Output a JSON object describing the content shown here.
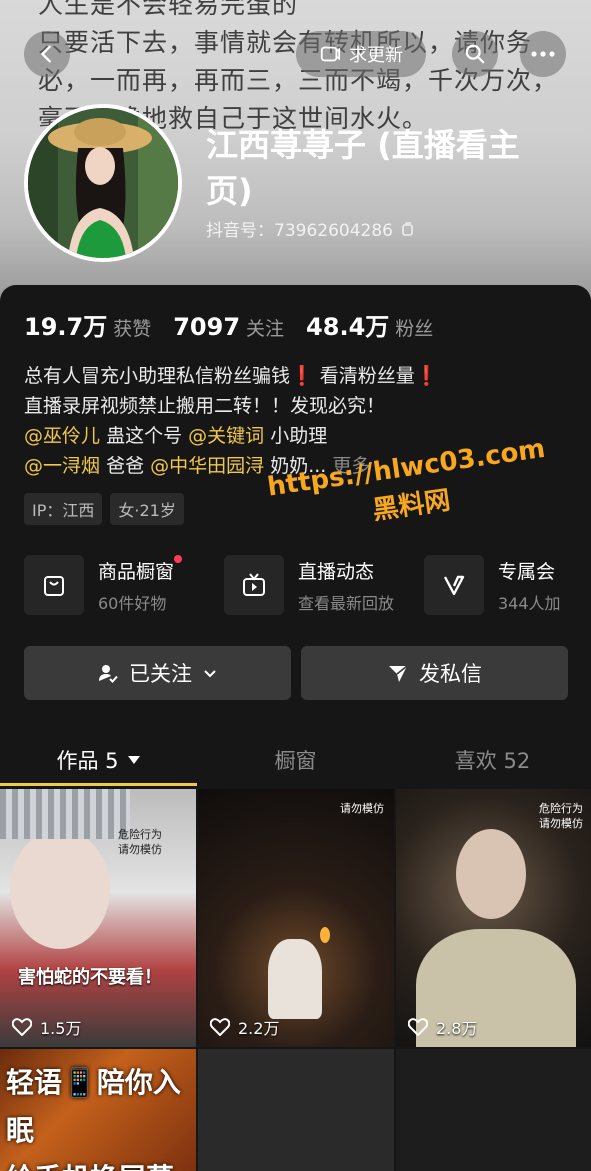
{
  "banner": {
    "background_text": "人生是不会轻易完蛋的\n只要活下去，事情就会有转机所以，请你务必，一而再，再而三，三而不竭，千次万次，毫不犹豫地救自己于这世间水火。",
    "update_label": "求更新"
  },
  "profile": {
    "name": "江西荨荨子 (直播看主页)",
    "douyin_id": "抖音号：73962604286"
  },
  "stats": [
    {
      "value": "19.7万",
      "label": "获赞"
    },
    {
      "value": "7097",
      "label": "关注"
    },
    {
      "value": "48.4万",
      "label": "粉丝"
    }
  ],
  "bio": {
    "line1": "总有人冒充小助理私信粉丝骗钱",
    "line1b": "看清粉丝量",
    "line2": "直播录屏视频禁止搬用二转！！发现必究！",
    "line3_tag1": "@巫伶儿",
    "line3_text": "蛊这个号",
    "line3_tag2": "@关键词",
    "line3_text2": "小助理",
    "line4_tag1": "@一浔烟",
    "line4_text": "爸爸",
    "line4_tag2": "@中华田园浔",
    "line4_text2": "奶奶...",
    "more": "更多",
    "exclaim": "❗"
  },
  "chips": [
    "IP：江西",
    "女·21岁"
  ],
  "watermark": {
    "url": "https://hlwc03.com",
    "brand": "黑料网"
  },
  "services": [
    {
      "title": "商品橱窗",
      "sub": "60件好物",
      "icon": "shopping-bag-icon"
    },
    {
      "title": "直播动态",
      "sub": "查看最新回放",
      "icon": "tv-icon"
    },
    {
      "title": "专属会",
      "sub": "344人加",
      "icon": "v-badge-icon"
    }
  ],
  "actions": {
    "followed": "已关注",
    "message": "发私信"
  },
  "tabs": [
    {
      "label": "作品 5",
      "active": true
    },
    {
      "label": "橱窗",
      "active": false
    },
    {
      "label": "喜欢 52",
      "active": false
    }
  ],
  "videos": [
    {
      "likes": "1.5万",
      "caption": "害怕蛇的不要看！",
      "warning": "危险行为\n请勿模仿"
    },
    {
      "likes": "2.2万",
      "caption": "",
      "warning": "请勿模仿"
    },
    {
      "likes": "2.8万",
      "caption": "",
      "warning": "危险行为\n请勿模仿"
    },
    {
      "likes": "",
      "caption": "轻语📱陪你入眠\n给手机换屏幕",
      "warning": ""
    },
    {
      "likes": "",
      "caption": "",
      "warning": ""
    },
    {
      "likes": "",
      "caption": "",
      "warning": ""
    }
  ],
  "colors": {
    "accent_yellow": "#f2c84b",
    "watermark_orange": "#f7a81e",
    "notify_red": "#ff3b5c"
  }
}
